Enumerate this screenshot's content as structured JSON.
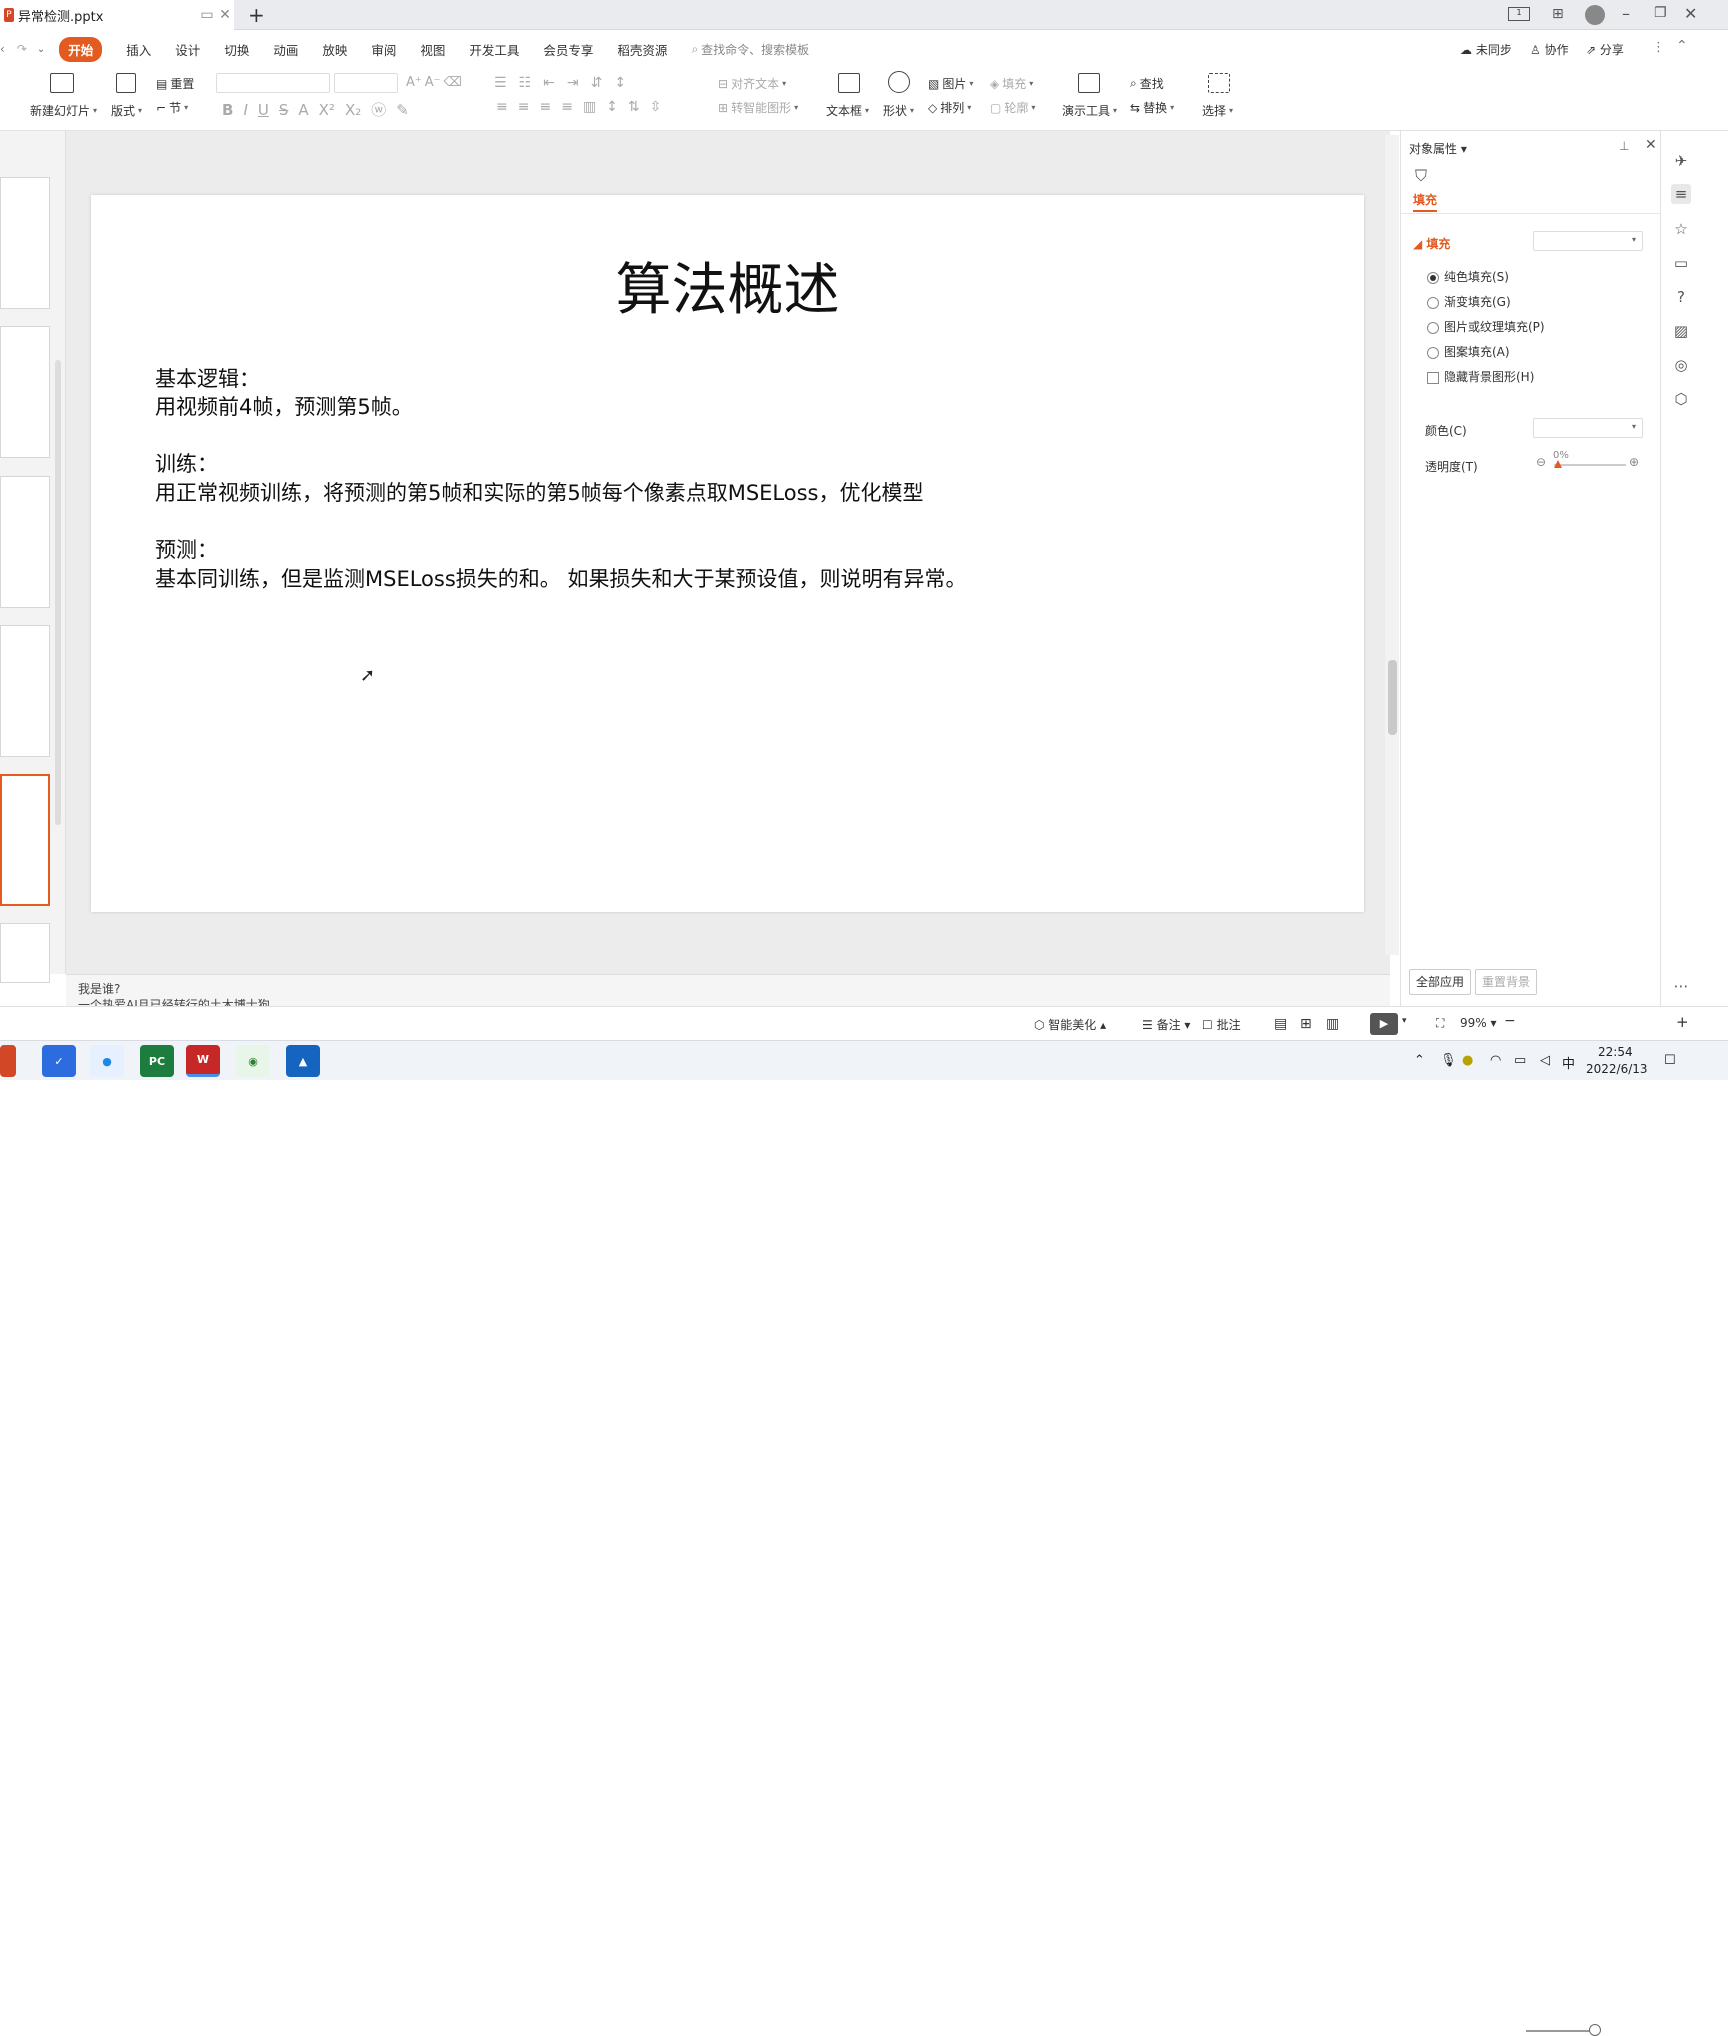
{
  "window": {
    "doc_title": "异常检测.pptx",
    "new_tab_icon": "+",
    "controls": [
      "minimize-icon",
      "restore-icon",
      "close-icon"
    ]
  },
  "menu": {
    "items": [
      "开始",
      "插入",
      "设计",
      "切换",
      "动画",
      "放映",
      "审阅",
      "视图",
      "开发工具",
      "会员专享",
      "稻壳资源"
    ],
    "search_placeholder": "查找命令、搜索模板",
    "sync": "未同步",
    "collab": "协作",
    "share": "分享"
  },
  "ribbon": {
    "new_slide": "新建幻灯片",
    "layout": "版式",
    "reset": "重置",
    "section": "节",
    "align_text": "对齐文本",
    "smart_art": "转智能图形",
    "textbox": "文本框",
    "shape": "形状",
    "picture": "图片",
    "fill": "填充",
    "arrange": "排列",
    "outline": "轮廓",
    "present_tools": "演示工具",
    "find": "查找",
    "replace": "替换",
    "select": "选择",
    "accent": "#e35b20"
  },
  "slide": {
    "title": "算法概述",
    "lines": [
      "基本逻辑：",
      "用视频前4帧，预测第5帧。",
      "训练：",
      "用正常视频训练，将预测的第5帧和实际的第5帧每个像素点取MSELoss，优化模型",
      "预测：",
      "基本同训练，但是监测MSELoss损失的和。 如果损失和大于某预设值，则说明有异常。"
    ]
  },
  "notes": {
    "line1": "我是谁?",
    "line2": "一个热爱AI且已经转行的土木博士狗"
  },
  "panel": {
    "title": "对象属性",
    "tab": "填充",
    "section": "填充",
    "options": [
      "纯色填充(S)",
      "渐变填充(G)",
      "图片或纹理填充(P)",
      "图案填充(A)"
    ],
    "hide_bg": "隐藏背景图形(H)",
    "color_label": "颜色(C)",
    "transparency_label": "透明度(T)",
    "transparency_value": "0%",
    "apply_all": "全部应用",
    "reset_bg": "重置背景"
  },
  "status": {
    "beautify": "智能美化",
    "notes": "备注",
    "comment": "批注",
    "zoom": "99%"
  },
  "taskbar": {
    "ime": "中",
    "time": "22:54",
    "date": "2022/6/13"
  }
}
